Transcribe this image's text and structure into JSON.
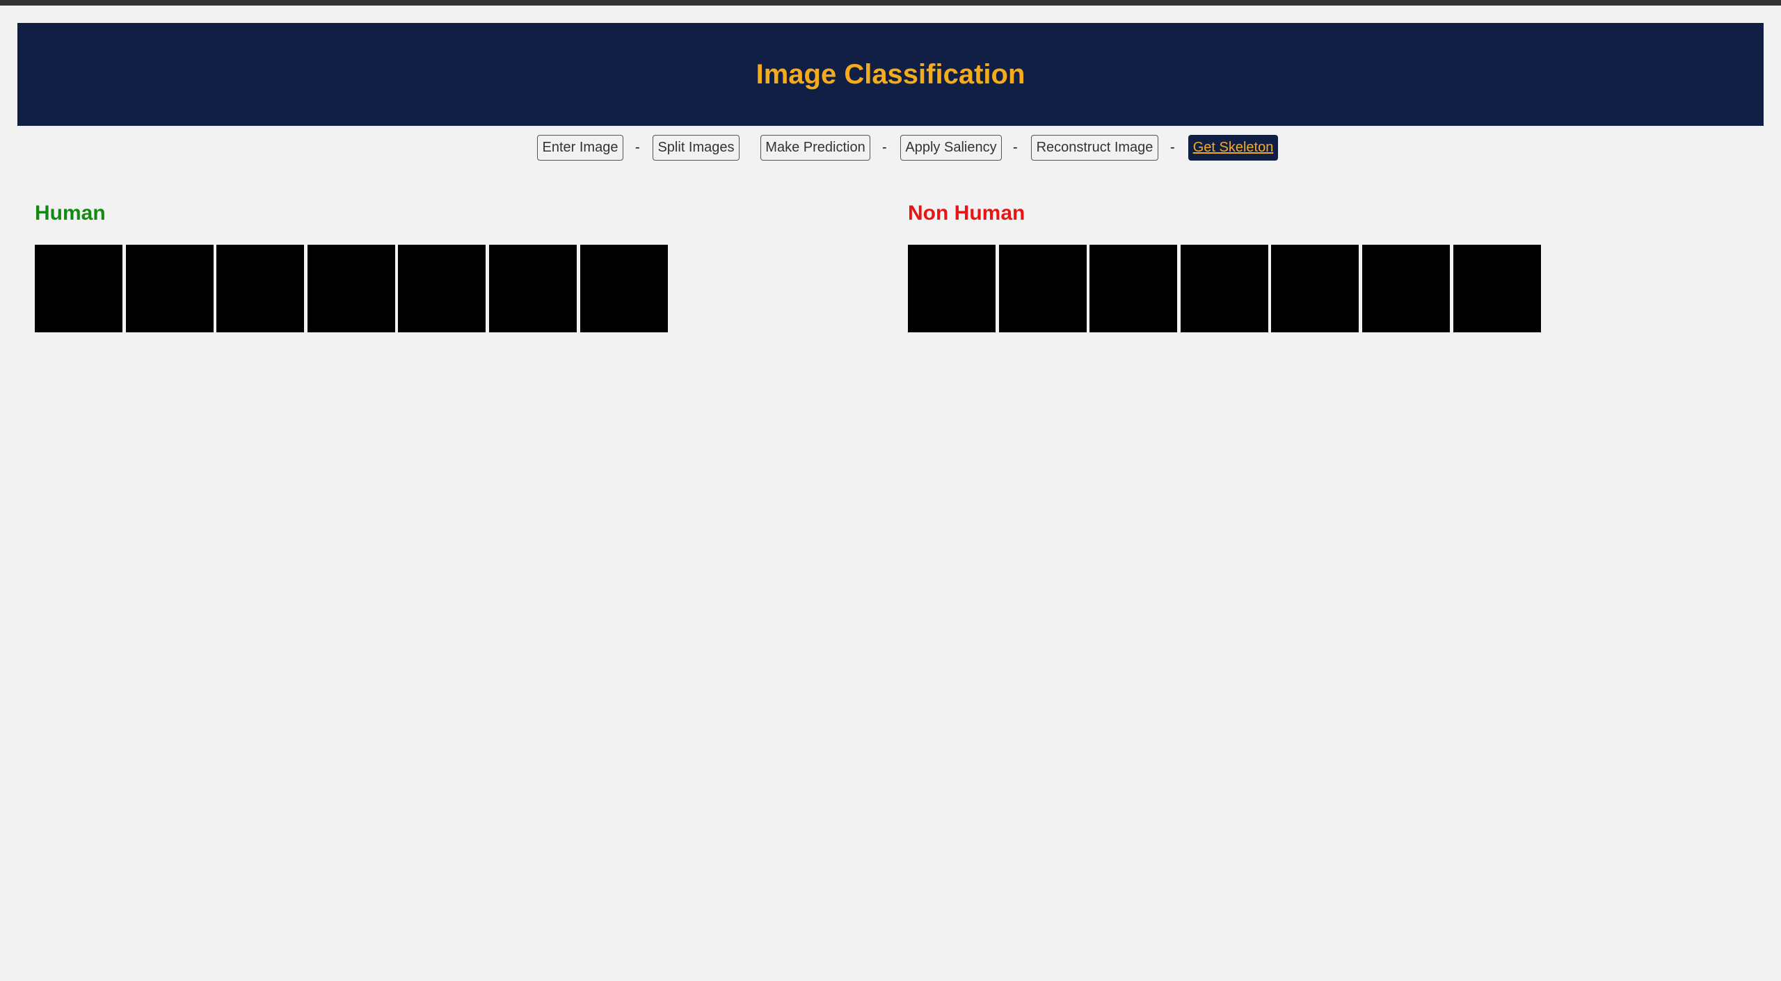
{
  "app": {
    "title": "Image Classification"
  },
  "nav": {
    "items": [
      {
        "label": "Enter Image",
        "active": false
      },
      {
        "label": "Split Images",
        "active": false
      },
      {
        "label": "Make Prediction",
        "active": false
      },
      {
        "label": "Apply Saliency",
        "active": false
      },
      {
        "label": "Reconstruct Image",
        "active": false
      },
      {
        "label": "Get Skeleton",
        "active": true
      }
    ],
    "separator": "-"
  },
  "sections": {
    "human": {
      "title": "Human",
      "color": "#138a13",
      "image_count": 7
    },
    "non_human": {
      "title": "Non Human",
      "color": "#e81515",
      "image_count": 7
    }
  },
  "colors": {
    "header_bg": "#111f44",
    "header_text": "#f5ac1c",
    "page_bg": "#f2f2f2",
    "tile_fill": "#000000"
  }
}
